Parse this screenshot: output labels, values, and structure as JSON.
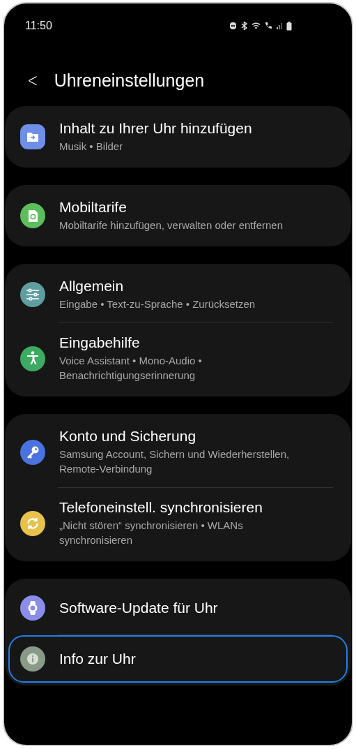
{
  "status_bar": {
    "time": "11:50"
  },
  "header": {
    "back": "<",
    "title": "Uhreneinstellungen"
  },
  "groups": [
    {
      "items": [
        {
          "kind": "folder",
          "color": "#6f8ee8",
          "title": "Inhalt zu Ihrer Uhr hinzufügen",
          "subtitle": "Musik • Bilder",
          "highlighted": false
        }
      ]
    },
    {
      "items": [
        {
          "kind": "sim",
          "color": "#5cbf5c",
          "title": "Mobiltarife",
          "subtitle": "Mobiltarife hinzufügen, verwalten oder entfernen",
          "highlighted": false
        }
      ]
    },
    {
      "items": [
        {
          "kind": "sliders",
          "color": "#5f9ea0",
          "title": "Allgemein",
          "subtitle": "Eingabe • Text-zu-Sprache • Zurücksetzen",
          "highlighted": false
        },
        {
          "kind": "accessibility",
          "color": "#3daa63",
          "title": "Eingabehilfe",
          "subtitle": "Voice Assistant • Mono-Audio • Benachrichtigungserinnerung",
          "highlighted": false
        }
      ]
    },
    {
      "items": [
        {
          "kind": "key",
          "color": "#4a72e0",
          "title": "Konto und Sicherung",
          "subtitle": "Samsung Account, Sichern und Wiederherstellen, Remote-Verbindung",
          "highlighted": false
        },
        {
          "kind": "sync",
          "color": "#e6c24a",
          "title": "Telefoneinstell. synchronisieren",
          "subtitle": "„Nicht stören“ synchronisieren • WLANs synchronisieren",
          "highlighted": false
        }
      ]
    },
    {
      "items": [
        {
          "kind": "watch",
          "color": "#8a8ee8",
          "title": "Software-Update für Uhr",
          "highlighted": false
        },
        {
          "kind": "info",
          "color": "#8a9a88",
          "title": "Info zur Uhr",
          "highlighted": true
        }
      ]
    }
  ]
}
